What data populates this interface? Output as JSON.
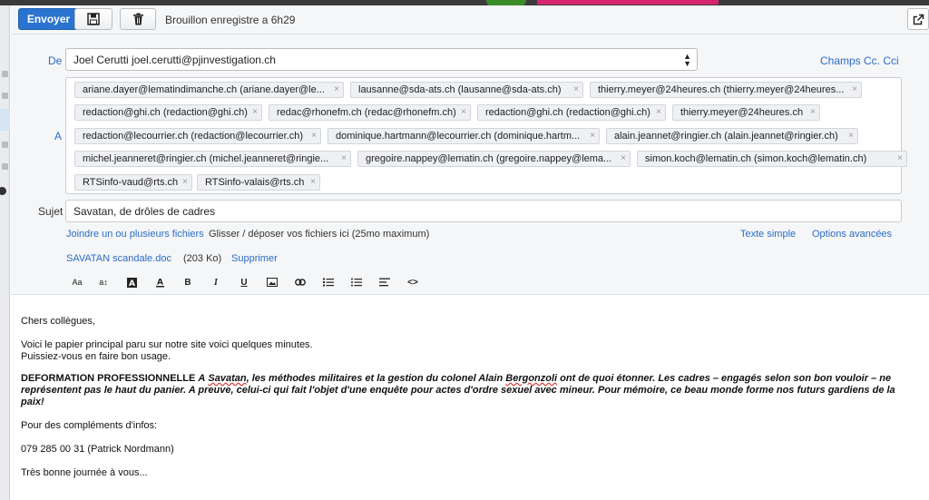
{
  "toolbar": {
    "send_label": "Envoyer",
    "save_icon": "floppy-disk-icon",
    "delete_icon": "trash-icon",
    "draft_status": "Brouillon enregistre a 6h29",
    "popout_icon": "popout-icon"
  },
  "from": {
    "label": "De",
    "value": "Joel Cerutti joel.cerutti@pjinvestigation.ch",
    "cc_link": "Champs Cc. Cci"
  },
  "to": {
    "label": "A",
    "recipients": [
      "ariane.dayer@lematindimanche.ch (ariane.dayer@le...",
      "lausanne@sda-ats.ch (lausanne@sda-ats.ch)",
      "thierry.meyer@24heures.ch (thierry.meyer@24heures...",
      "redaction@ghi.ch (redaction@ghi.ch)",
      "redac@rhonefm.ch (redac@rhonefm.ch)",
      "redaction@ghi.ch (redaction@ghi.ch)",
      "thierry.meyer@24heures.ch",
      "redaction@lecourrier.ch (redaction@lecourrier.ch)",
      "dominique.hartmann@lecourrier.ch (dominique.hartm...",
      "alain.jeannet@ringier.ch (alain.jeannet@ringier.ch)",
      "michel.jeanneret@ringier.ch (michel.jeanneret@ringie...",
      "gregoire.nappey@lematin.ch (gregoire.nappey@lema...",
      "simon.koch@lematin.ch (simon.koch@lematin.ch)",
      "RTSinfo-vaud@rts.ch",
      "RTSinfo-valais@rts.ch"
    ],
    "remove_glyph": "×"
  },
  "subject": {
    "label": "Sujet",
    "value": "Savatan, de drôles de cadres"
  },
  "attach": {
    "link": "Joindre un ou plusieurs fichiers",
    "hint": "Glisser / déposer vos fichiers ici (25mo maximum)",
    "plain_text_link": "Texte simple",
    "advanced_link": "Options avancées",
    "file_name": "SAVATAN scandale.doc",
    "file_size": "(203 Ko)",
    "remove_link": "Supprimer"
  },
  "format": {
    "font_size": "Aa",
    "line_height": "a↕",
    "bold": "B",
    "italic": "I",
    "underline": "U",
    "code": "<>"
  },
  "body": {
    "greeting": "Chers collègues,",
    "line1": "Voici le papier principal paru sur notre site voici quelques minutes.",
    "line2": "Puissiez-vous en faire bon usage.",
    "p_caps": "DEFORMATION PROFESSIONNELLE",
    "p_a": "A",
    "p_savatan": "Savatan",
    "p_mid": ", les méthodes militaires et la gestion du colonel Alain",
    "p_bergonzoli": "Bergonzoli",
    "p_rest": "ont de quoi étonner. Les cadres – engagés selon son bon vouloir – ne représentent pas le haut du panier. A preuve, celui-ci qui fait l'objet d'une enquête pour actes d'ordre sexuel avec mineur. Pour mémoire, ce beau monde forme nos futurs gardiens de la paix!",
    "complements": "Pour des compléments d'infos:",
    "phone": "079 285 00 31 (Patrick Nordmann)",
    "closing": "Très bonne journée à vous..."
  },
  "colors": {
    "accent": "#2a74d0",
    "link": "#2a6cc5"
  }
}
